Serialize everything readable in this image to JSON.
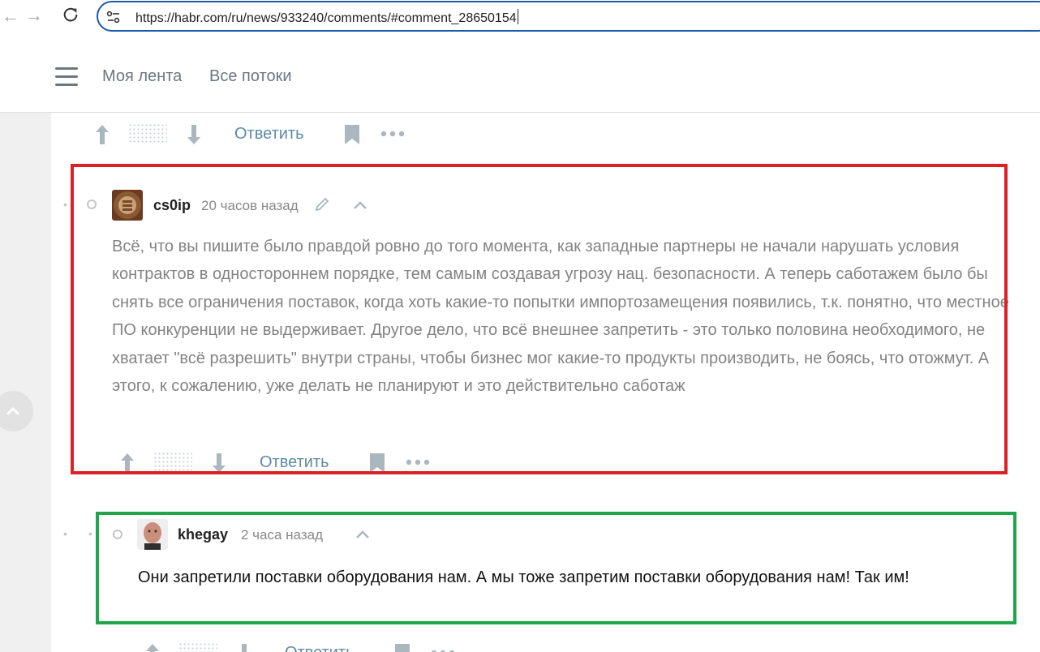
{
  "browser": {
    "url": "https://habr.com/ru/news/933240/comments/#comment_28650154",
    "back_icon": "arrow-left-icon",
    "forward_icon": "arrow-right-icon",
    "reload_icon": "reload-icon",
    "site_info_icon": "tune-icon"
  },
  "header": {
    "links": [
      "Моя лента",
      "Все потоки"
    ]
  },
  "actions": {
    "reply_label": "Ответить"
  },
  "comments": [
    {
      "author": "cs0ip",
      "time": "20 часов назад",
      "text": "Всё, что вы пишите было правдой ровно до того момента, как западные партнеры не начали нарушать условия контрактов в одностороннем порядке, тем самым создавая угрозу нац. безопасности. А теперь саботажем было бы снять все ограничения поставок, когда хоть какие-то попытки импортозамещения появились, т.к. понятно, что местное ПО конкуренции не выдерживает. Другое дело, что всё внешнее запретить - это только половина необходимого, не хватает \"всё разрешить\" внутри страны, чтобы бизнес мог какие-то продукты производить, не боясь, что отожмут. А этого, к сожалению, уже делать не планируют и это действительно саботаж"
    },
    {
      "author": "khegay",
      "time": "2 часа назад",
      "text": "Они запретили поставки оборудования нам. А мы тоже запретим поставки оборудования нам! Так им!"
    }
  ],
  "colors": {
    "highlight_red": "#dc2126",
    "highlight_green": "#20a64a",
    "link": "#5e8aa6"
  }
}
